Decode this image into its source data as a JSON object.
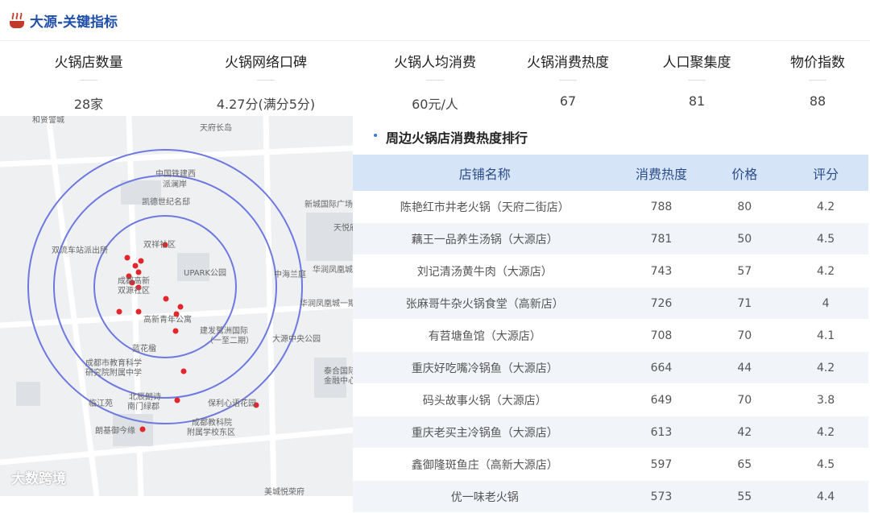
{
  "header": {
    "title": "大源-关键指标",
    "icon": "hotpot-icon",
    "icon_color": "#c0392b"
  },
  "kpis": [
    {
      "label": "火锅店数量",
      "value": "28家"
    },
    {
      "label": "火锅网络口碑",
      "value": "4.27分(满分5分)"
    },
    {
      "label": "火锅人均消费",
      "value": "60元/人"
    },
    {
      "label": "火锅消费热度",
      "value": "67"
    },
    {
      "label": "人口聚集度",
      "value": "81"
    },
    {
      "label": "物价指数",
      "value": "88"
    }
  ],
  "map": {
    "labels": [
      "和贤警城",
      "天府长岛",
      "中国铁建西",
      "派澜岸",
      "凯德世纪名邸",
      "新城国际广场",
      "天悦府",
      "双流车站派出所",
      "双祥社区",
      "UPARK公园",
      "华润凤凰城",
      "中海兰庭",
      "成都高新",
      "双源社区",
      "华润凤凰城一期",
      "高新青年公寓",
      "建发鹭洲国际",
      "（一至二期）",
      "大源中央公园",
      "蓝花楹",
      "成都市教育科学",
      "研究院附属中学",
      "泰合国际",
      "金融中心",
      "临江苑",
      "北辰朗诗",
      "南门绿郡",
      "保利心语花园",
      "朗基御今缘",
      "成都教科院",
      "附属学校东区",
      "美城悦荣府"
    ],
    "ring_color": "#6f78e0",
    "marker_color": "#e3262b"
  },
  "ranking": {
    "title": "周边火锅店消费热度排行",
    "headers": [
      "店铺名称",
      "消费热度",
      "价格",
      "评分"
    ],
    "rows": [
      [
        "陈艳红市井老火锅（天府二街店）",
        "788",
        "80",
        "4.2"
      ],
      [
        "藕王一品养生汤锅（大源店）",
        "781",
        "50",
        "4.5"
      ],
      [
        "刘记清汤黄牛肉（大源店）",
        "743",
        "57",
        "4.2"
      ],
      [
        "张麻哥牛杂火锅食堂（高新店）",
        "726",
        "71",
        "4"
      ],
      [
        "有苕塘鱼馆（大源店）",
        "708",
        "70",
        "4.1"
      ],
      [
        "重庆好吃嘴冷锅鱼（大源店）",
        "664",
        "44",
        "4.2"
      ],
      [
        "码头故事火锅（大源店）",
        "649",
        "70",
        "3.8"
      ],
      [
        "重庆老买主冷锅鱼（大源店）",
        "613",
        "42",
        "4.2"
      ],
      [
        "鑫御隆斑鱼庄（高新大源店）",
        "597",
        "65",
        "4.5"
      ],
      [
        "优一味老火锅",
        "573",
        "55",
        "4.4"
      ]
    ]
  },
  "footer": {
    "brand": "大数跨境"
  }
}
